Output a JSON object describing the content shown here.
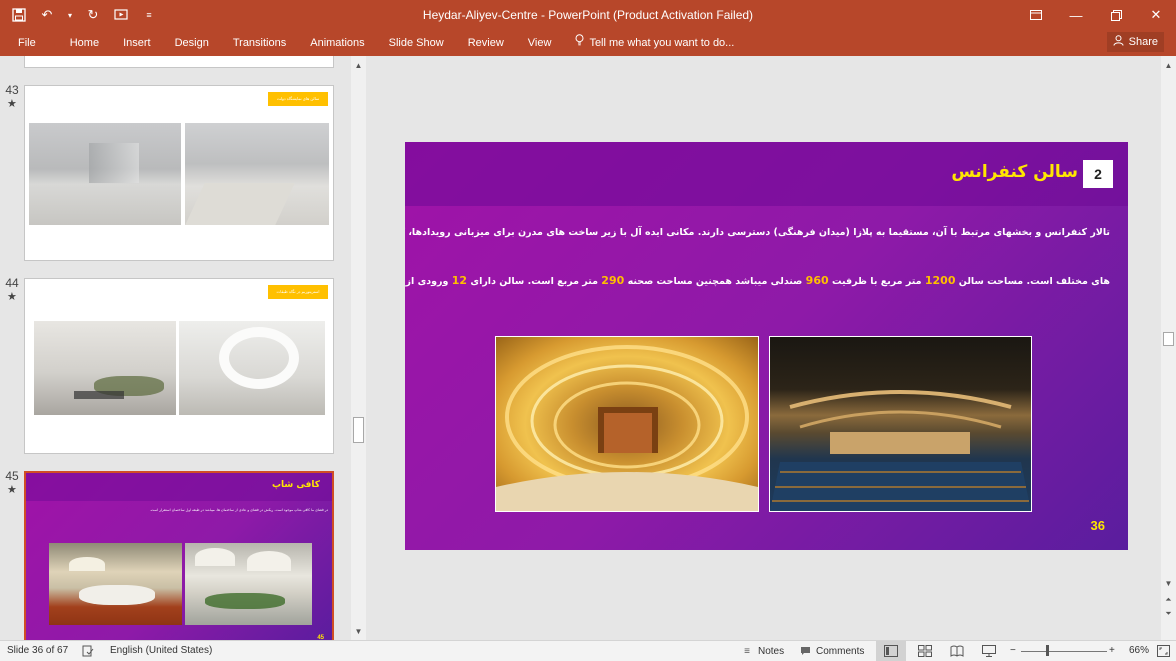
{
  "window": {
    "title": "Heydar-Aliyev-Centre - PowerPoint (Product Activation Failed)"
  },
  "ribbon": {
    "tabs": [
      "File",
      "Home",
      "Insert",
      "Design",
      "Transitions",
      "Animations",
      "Slide Show",
      "Review",
      "View"
    ],
    "tell_me": "Tell me what you want to do...",
    "share": "Share"
  },
  "thumbnails": [
    {
      "number": "43",
      "tag": "سالن های نمایشگاه دولت"
    },
    {
      "number": "44",
      "tag": "استریتوریم در نگاه طبقات"
    },
    {
      "number": "45",
      "title": "کافی شاپ",
      "text": "در فضای ما کافی شاپ موجود است. ریکش در فضای و عادی از ساختمان ها. میباشد در طبقه اول ساختمان استقرار است.",
      "page": "45"
    }
  ],
  "slide": {
    "number_box": "2",
    "title": "سالن کنفرانس",
    "line1": "تالار کنفرانس و بخشهای مرتبط با آن، مستقیما به پلازا (میدان فرهنگی) دسترسی دارند. مکانی ایده آل با زیر ساخت های مدرن برای میزبانی رویدادها، کنفرانس ها، کنسرت",
    "line2": {
      "a": "های مختلف است. مساحت سالن",
      "v1": "1200",
      "b": "متر مربع با ظرفیت",
      "v2": "960",
      "c": "صندلی میباشد همچنین مساحت صحنه",
      "v3": "290",
      "d": "متر مربع است. سالن دارای",
      "v4": "12",
      "e": "ورودی از طبقات مختلف میباشد."
    },
    "page_number": "36"
  },
  "status": {
    "slide_info": "Slide 36 of 67",
    "language": "English (United States)",
    "notes": "Notes",
    "comments": "Comments",
    "zoom": "66%"
  }
}
